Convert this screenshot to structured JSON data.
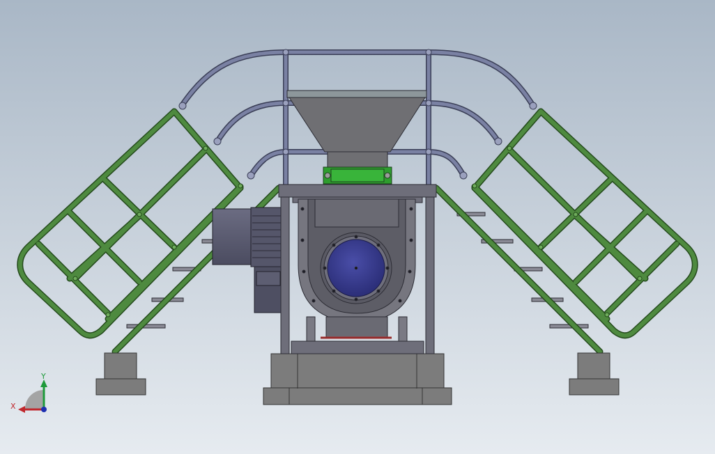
{
  "viewport": {
    "background_top": "#a9b7c6",
    "background_bottom": "#e6ebf0"
  },
  "colors": {
    "rail_green": "#4e8a3f",
    "rail_green_edge": "#244a1c",
    "rail_gray": "#737a9a",
    "rail_gray_edge": "#3a3e56",
    "steel": "#6e6e7a",
    "steel_edge": "#2c2c34",
    "concrete": "#7c7c7c",
    "concrete_edge": "#333333",
    "motor": "#5e5f74",
    "valve_disc": "#3c3f8f",
    "valve_inner": "#2a2c6a",
    "coupling_green": "#2e9d2e",
    "hopper": "#6f6f73",
    "rod_red": "#a33"
  },
  "triad": {
    "x_label": "X",
    "y_label": "Y",
    "x_color": "#c0282d",
    "y_color": "#1e9a3a",
    "z_color": "#1d2fb0"
  }
}
